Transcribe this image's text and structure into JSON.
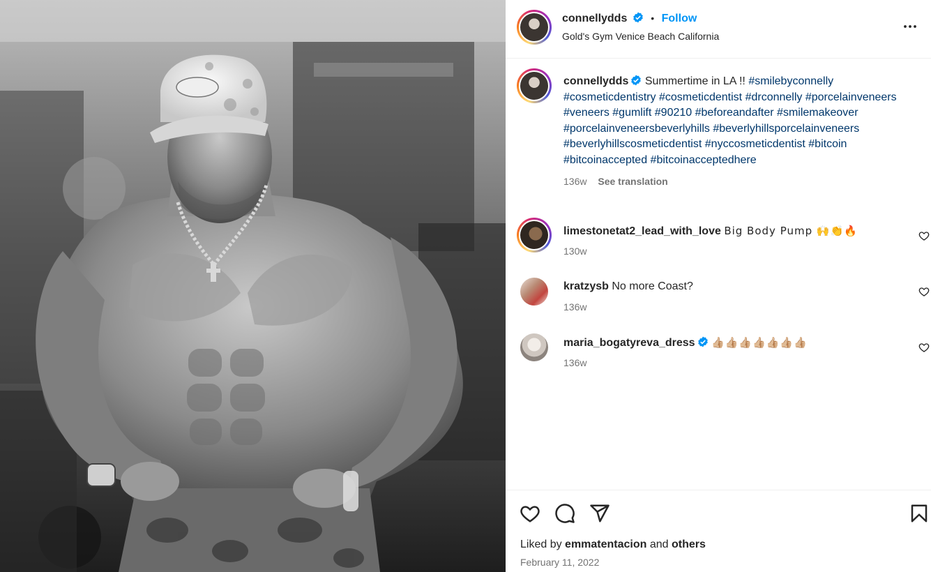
{
  "post": {
    "username": "connellydds",
    "dot": "•",
    "follow_label": "Follow",
    "location": "Gold's Gym Venice Beach California",
    "more_icon": "more-horizontal-icon"
  },
  "caption": {
    "username": "connellydds",
    "text": "Summertime in LA !!",
    "hashtags": [
      "#smilebyconnelly",
      "#cosmeticdentistry",
      "#cosmeticdentist",
      "#drconnelly",
      "#porcelainveneers",
      "#veneers",
      "#gumlift",
      "#90210",
      "#beforeandafter",
      "#smilemakeover",
      "#porcelainveneersbeverlyhills",
      "#beverlyhillsporcelainveneers",
      "#beverlyhillscosmeticdentist",
      "#nyccosmeticdentist",
      "#bitcoin",
      "#bitcoinaccepted",
      "#bitcoinacceptedhere"
    ],
    "time": "136w",
    "see_translation": "See translation"
  },
  "comments": [
    {
      "username": "limestonetat2_lead_with_love",
      "text": "Big Body Pump 🙌👏🔥",
      "time": "130w"
    },
    {
      "username": "kratzysb",
      "text": "No more Coast?",
      "time": "136w"
    },
    {
      "username": "maria_bogatyreva_dress",
      "text": "👍🏼👍🏼👍🏼👍🏼👍🏼👍🏼👍🏼",
      "time": "136w"
    }
  ],
  "footer": {
    "liked_by_prefix": "Liked by",
    "liked_by_user": "emmatentacion",
    "and": "and",
    "others": "others",
    "date": "February 11, 2022"
  },
  "colors": {
    "accent": "#0095f6",
    "hashtag": "#00376b",
    "muted": "#737373",
    "verified": "#0095f6"
  }
}
